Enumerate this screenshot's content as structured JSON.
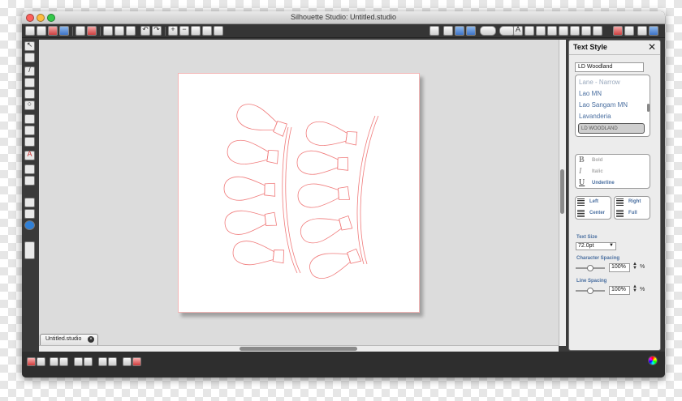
{
  "window": {
    "title": "Silhouette Studio: Untitled.studio"
  },
  "toolbar": {
    "left_icons": [
      "new-document-icon",
      "open-icon",
      "save-icon",
      "save-to-library-icon",
      "print-icon",
      "print-cut-icon",
      "cut-icon",
      "copy-icon",
      "paste-icon",
      "undo-icon",
      "redo-icon",
      "zoom-in-icon",
      "zoom-out-icon",
      "zoom-select-icon",
      "pan-icon",
      "fit-to-page-icon"
    ],
    "right_icons": [
      "page-setup-icon",
      "cut-settings-icon",
      "send-to-cutter-icon",
      "registration-icon",
      "grid-icon",
      "line-style-icon",
      "fill-color-icon",
      "text-style-icon",
      "transform-icon",
      "replicate-icon",
      "modify-icon",
      "offset-icon",
      "trace-icon",
      "library-icon",
      "store-icon"
    ]
  },
  "toolbox": [
    "select-icon",
    "point-edit-icon",
    "line-icon",
    "rectangle-icon",
    "rounded-rectangle-icon",
    "ellipse-icon",
    "polygon-icon",
    "curve-icon",
    "freehand-icon",
    "text-icon",
    "eraser-icon",
    "knife-icon",
    "library-panel-icon",
    "store-panel-icon",
    "online-icon",
    "panel-toggle-icon"
  ],
  "document": {
    "tab_label": "Untitled.studio"
  },
  "cut_color": "#f07b7b",
  "text_style_panel": {
    "title": "Text Style",
    "font_field_value": "LD Woodland",
    "font_list": [
      "Lane - Narrow",
      "Lao MN",
      "Lao Sangam MN",
      "Lavanderia"
    ],
    "selected_font": "LD WOODLAND",
    "styles": [
      {
        "glyph": "B",
        "label": "Bold"
      },
      {
        "glyph": "I",
        "label": "Italic"
      },
      {
        "glyph": "U",
        "label": "Underline"
      }
    ],
    "alignment": {
      "left": "Left",
      "right": "Right",
      "center": "Center",
      "full": "Full"
    },
    "text_size_label": "Text Size",
    "text_size_value": "72.0pt",
    "char_spacing_label": "Character Spacing",
    "char_spacing_value": "100%",
    "line_spacing_label": "Line Spacing",
    "line_spacing_value": "100%",
    "percent_symbol": "%"
  },
  "statusbar": [
    "select-all-icon",
    "group-icon",
    "ungroup-icon",
    "duplicate-icon",
    "delete-icon",
    "weld-icon",
    "offset-status-icon",
    "camera-icon",
    "stop-icon",
    "color-palette-icon"
  ]
}
